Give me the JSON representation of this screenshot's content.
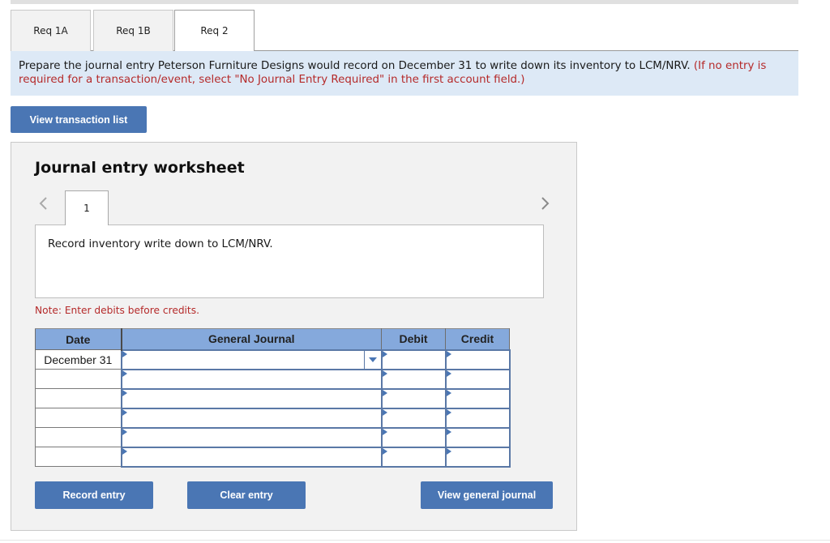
{
  "tabs": [
    {
      "label": "Req 1A",
      "active": false
    },
    {
      "label": "Req 1B",
      "active": false
    },
    {
      "label": "Req 2",
      "active": true
    }
  ],
  "instructions": {
    "main": "Prepare the journal entry Peterson Furniture Designs would record on December 31 to write down its inventory to LCM/NRV.",
    "hint": "(If no entry is required for a transaction/event, select \"No Journal Entry Required\" in the first account field.)"
  },
  "buttons": {
    "view_transaction_list": "View transaction list",
    "record_entry": "Record entry",
    "clear_entry": "Clear entry",
    "view_general_journal": "View general journal"
  },
  "worksheet": {
    "title": "Journal entry worksheet",
    "entry_number": "1",
    "description": "Record inventory write down to LCM/NRV.",
    "note": "Note: Enter debits before credits.",
    "columns": [
      "Date",
      "General Journal",
      "Debit",
      "Credit"
    ],
    "rows": [
      {
        "date": "December 31",
        "account": "",
        "debit": "",
        "credit": ""
      },
      {
        "date": "",
        "account": "",
        "debit": "",
        "credit": ""
      },
      {
        "date": "",
        "account": "",
        "debit": "",
        "credit": ""
      },
      {
        "date": "",
        "account": "",
        "debit": "",
        "credit": ""
      },
      {
        "date": "",
        "account": "",
        "debit": "",
        "credit": ""
      },
      {
        "date": "",
        "account": "",
        "debit": "",
        "credit": ""
      }
    ]
  },
  "icons": {
    "prev": "chevron-left-icon",
    "next": "chevron-right-icon",
    "dropdown": "caret-down-icon",
    "field_marker": "triangle-right-icon"
  },
  "colors": {
    "accent": "#4a76b4",
    "header_blue": "#85a9dc",
    "instruction_bg": "#dde9f6",
    "hint_red": "#b52a2a",
    "panel_bg": "#f2f2f2"
  }
}
